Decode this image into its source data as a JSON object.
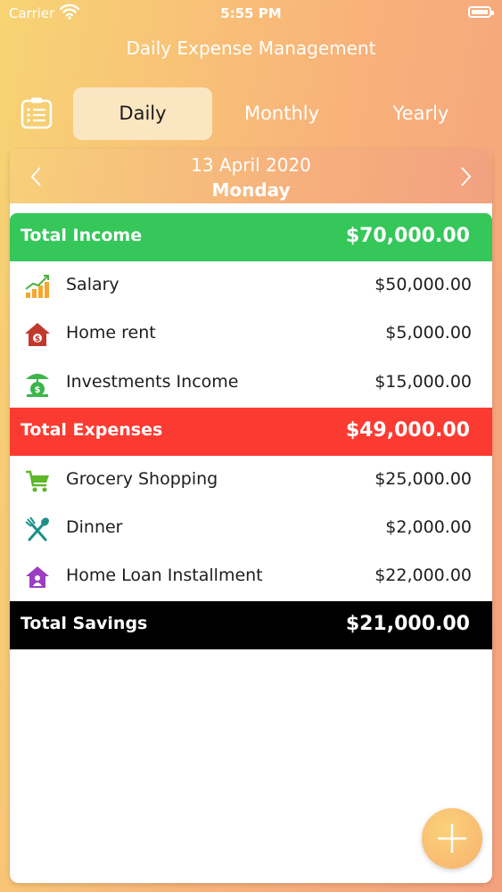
{
  "status_bar": {
    "carrier": "Carrier",
    "time": "5:55 PM"
  },
  "header": {
    "title": "Daily Expense Management"
  },
  "tabs": [
    {
      "label": "Daily",
      "active": true
    },
    {
      "label": "Monthly",
      "active": false
    },
    {
      "label": "Yearly",
      "active": false
    }
  ],
  "date": {
    "date_text": "13 April 2020",
    "weekday": "Monday"
  },
  "income": {
    "label": "Total Income",
    "total": "$70,000.00",
    "items": [
      {
        "icon": "salary-chart-icon",
        "label": "Salary",
        "amount": "$50,000.00"
      },
      {
        "icon": "house-dollar-icon",
        "label": "Home rent",
        "amount": "$5,000.00"
      },
      {
        "icon": "investment-money-bag-icon",
        "label": "Investments Income",
        "amount": "$15,000.00"
      }
    ]
  },
  "expenses": {
    "label": "Total Expenses",
    "total": "$49,000.00",
    "items": [
      {
        "icon": "shopping-cart-icon",
        "label": "Grocery Shopping",
        "amount": "$25,000.00"
      },
      {
        "icon": "fork-spoon-icon",
        "label": "Dinner",
        "amount": "$2,000.00"
      },
      {
        "icon": "house-person-icon",
        "label": "Home Loan Installment",
        "amount": "$22,000.00"
      }
    ]
  },
  "savings": {
    "label": "Total Savings",
    "total": "$21,000.00"
  },
  "colors": {
    "income_band": "#35c75a",
    "expense_band": "#fb3b32",
    "savings_band": "#000000",
    "accent_gradient_start": "#f7d474",
    "accent_gradient_end": "#f4a17e"
  }
}
